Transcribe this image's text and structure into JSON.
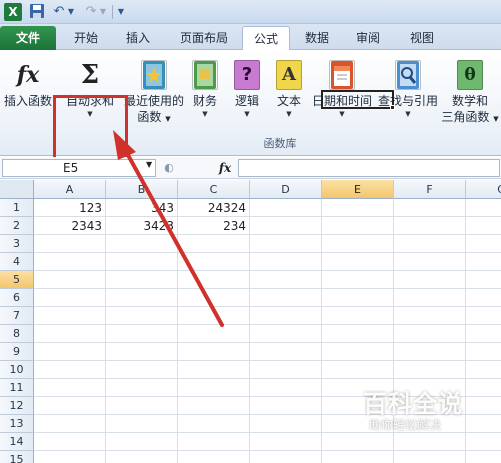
{
  "app": {
    "icon_label": "X",
    "title": ""
  },
  "quick_access": {
    "icons": [
      "excel-icon",
      "save-icon",
      "undo-icon",
      "redo-icon",
      "customize-icon"
    ]
  },
  "tabs": [
    {
      "label": "文件"
    },
    {
      "label": "开始"
    },
    {
      "label": "插入"
    },
    {
      "label": "页面布局"
    },
    {
      "label": "公式",
      "active": true
    },
    {
      "label": "数据"
    },
    {
      "label": "审阅"
    },
    {
      "label": "视图"
    }
  ],
  "ribbon": {
    "group_label": "函数库",
    "buttons": {
      "insert_function": {
        "label": "插入函数",
        "icon_text": "fx"
      },
      "autosum": {
        "label": "自动求和",
        "icon_text": "Σ"
      },
      "recent": {
        "label1": "最近使用的",
        "label2": "函数"
      },
      "financial": {
        "label": "财务"
      },
      "logical": {
        "label": "逻辑",
        "icon_text": "?"
      },
      "text": {
        "label": "文本",
        "icon_text": "A"
      },
      "datetime": {
        "label": "日期和时间"
      },
      "lookup": {
        "label": "查找与引用"
      },
      "math": {
        "label1": "数学和",
        "label2": "三角函数",
        "icon_text": "θ"
      }
    }
  },
  "formula_bar": {
    "name_box": "E5",
    "fx_label": "fx",
    "formula": ""
  },
  "sheet": {
    "columns": [
      "A",
      "B",
      "C",
      "D",
      "E",
      "F",
      "G"
    ],
    "rows": [
      "1",
      "2",
      "3",
      "4",
      "5",
      "6",
      "7",
      "8",
      "9",
      "10",
      "11",
      "12",
      "13",
      "14",
      "15"
    ],
    "selected_cell": "E5",
    "cells": {
      "A1": "123",
      "B1": "343",
      "C1": "24324",
      "A2": "2343",
      "B2": "3423",
      "C2": "234"
    }
  },
  "annotation": {
    "highlight_color": "#d0312b"
  },
  "watermark": {
    "title": "百科全说",
    "subtitle": "助你轻松解决"
  }
}
